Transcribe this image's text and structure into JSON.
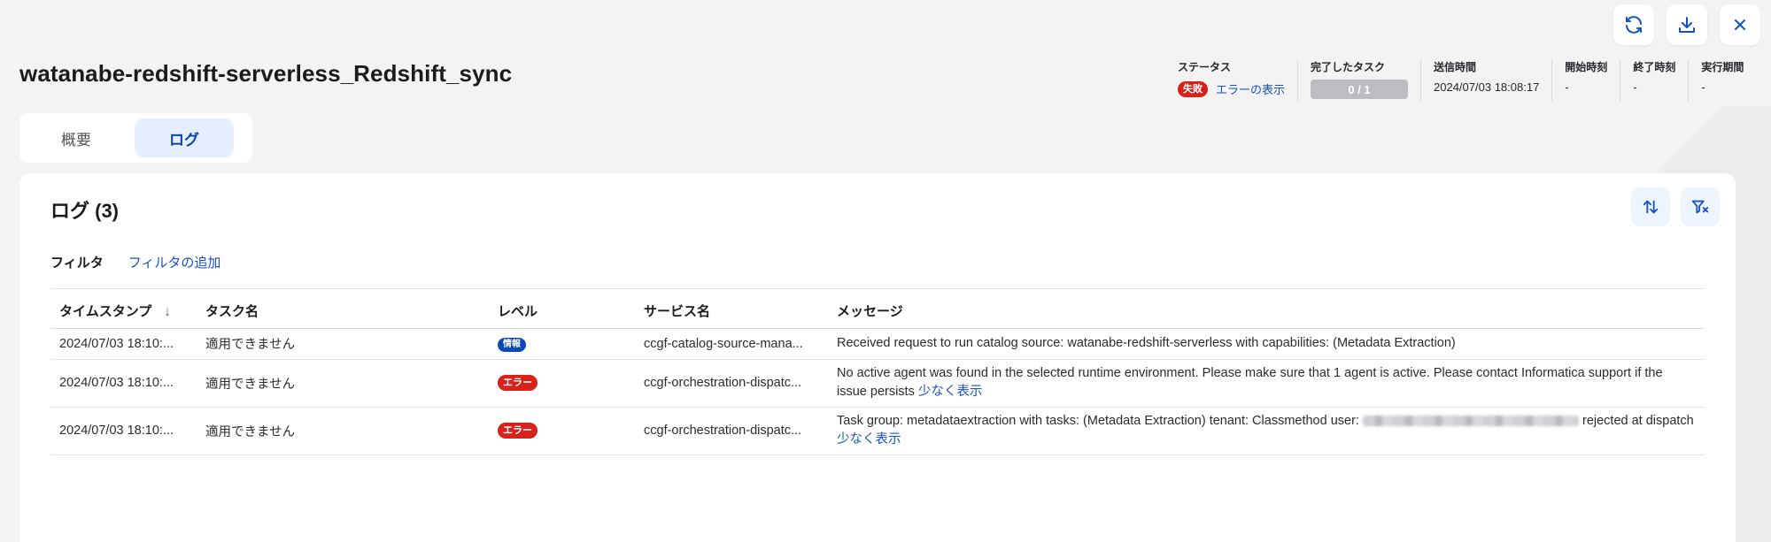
{
  "app": {
    "title": "watanabe-redshift-serverless_Redshift_sync"
  },
  "toolbar": {
    "refresh_icon": "refresh-icon",
    "download_icon": "download-icon",
    "close_icon": "close-icon"
  },
  "meta": {
    "status_label": "ステータス",
    "status_badge": "失敗",
    "status_link": "エラーの表示",
    "tasks_label": "完了したタスク",
    "tasks_value": "0 / 1",
    "sent_label": "送信時間",
    "sent_value": "2024/07/03 18:08:17",
    "start_label": "開始時刻",
    "start_value": "-",
    "end_label": "終了時刻",
    "end_value": "-",
    "duration_label": "実行期間",
    "duration_value": "-"
  },
  "tabs": [
    {
      "label": "概要",
      "active": false
    },
    {
      "label": "ログ",
      "active": true
    }
  ],
  "log": {
    "title": "ログ (3)",
    "filter_label": "フィルタ",
    "add_filter_link": "フィルタの追加",
    "columns": [
      "タイムスタンプ",
      "タスク名",
      "レベル",
      "サービス名",
      "メッセージ"
    ],
    "sort_indicator": "↓",
    "rows": [
      {
        "timestamp": "2024/07/03 18:10:...",
        "task": "適用できません",
        "level": "情報",
        "service": "ccgf-catalog-source-mana...",
        "message": "Received request to run catalog source: watanabe-redshift-serverless with capabilities: (Metadata Extraction)",
        "more_link": ""
      },
      {
        "timestamp": "2024/07/03 18:10:...",
        "task": "適用できません",
        "level": "エラー",
        "service": "ccgf-orchestration-dispatc...",
        "message": "No active agent was found in the selected runtime environment. Please make sure that 1 agent is active. Please contact Informatica support if the issue persists",
        "more_link": "少なく表示"
      },
      {
        "timestamp": "2024/07/03 18:10:...",
        "task": "適用できません",
        "level": "エラー",
        "service": "ccgf-orchestration-dispatc...",
        "message_prefix": "Task group: metadataextraction with tasks: (Metadata Extraction) tenant: Classmethod user:",
        "message_suffix": "rejected at dispatch",
        "more_link": "少なく表示"
      }
    ]
  },
  "colors": {
    "error_badge": "#d6221b",
    "info_badge": "#0b4ab3",
    "link": "#1552c4",
    "active_tab_bg": "#e5efff"
  }
}
